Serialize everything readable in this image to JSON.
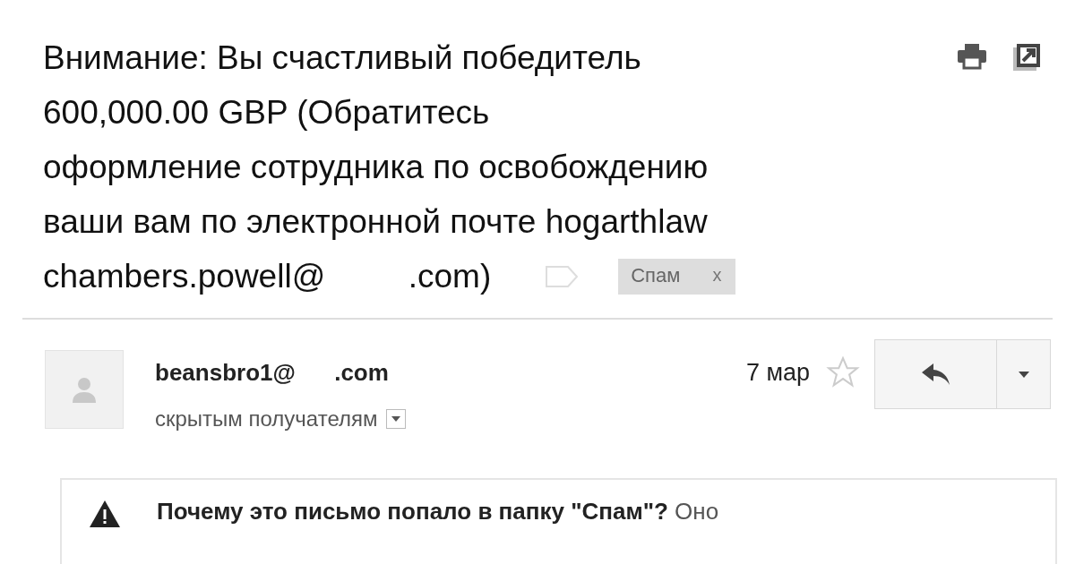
{
  "subject": {
    "lines": [
      "Внимание: Вы счастливый победитель",
      "600,000.00 GBP (Обратитесь",
      "оформление сотрудника по освобождению",
      "ваши вам по электронной почте hogarthlaw",
      "chambers.powell@         .com)"
    ],
    "labels": [
      {
        "text": "Спам",
        "remove": "x"
      }
    ]
  },
  "message": {
    "sender": "beansbro1@      .com",
    "recipients": "скрытым получателям",
    "date": "7 мар",
    "starred": false
  },
  "warning": {
    "title": "Почему это письмо попало в папку \"Спам\"?",
    "text": "Оно"
  }
}
